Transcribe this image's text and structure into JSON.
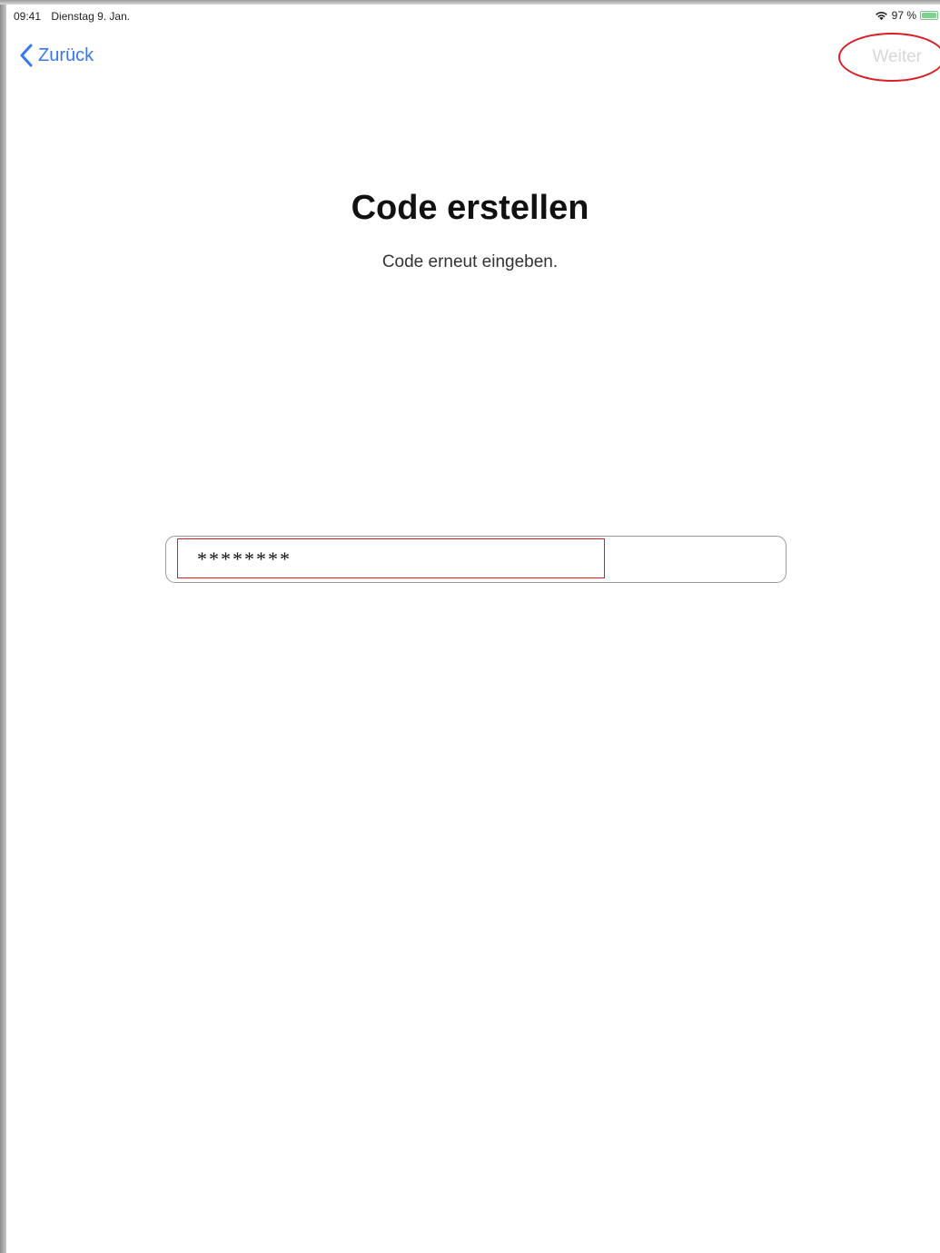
{
  "status_bar": {
    "time": "09:41",
    "date": "Dienstag 9. Jan.",
    "battery_percent": "97 %",
    "battery_level": 0.97
  },
  "nav": {
    "back_label": "Zurück",
    "next_label": "Weiter",
    "next_enabled": false
  },
  "main": {
    "title": "Code erstellen",
    "subtitle": "Code erneut eingeben.",
    "code_input": {
      "value": "********"
    }
  },
  "colors": {
    "accent": "#3478f6",
    "disabled_text": "#d7d7d7",
    "highlight": "#d91f26",
    "battery": "#7fd28c"
  }
}
